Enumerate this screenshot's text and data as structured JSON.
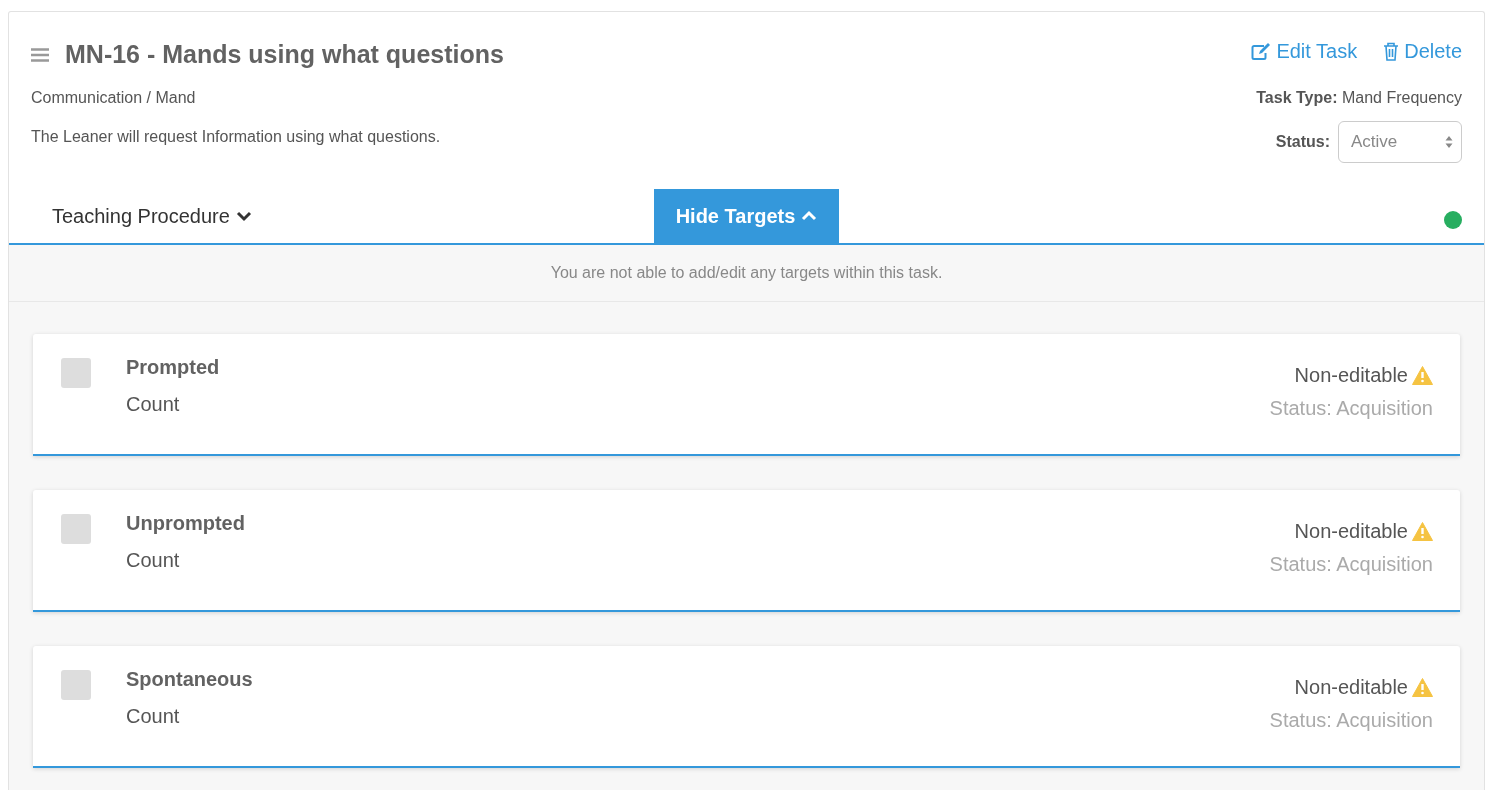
{
  "task": {
    "title": "MN-16 - Mands using what questions",
    "category": "Communication / Mand",
    "description": "The Leaner will request Information using what questions.",
    "actions": [
      {
        "kind": "edit",
        "label": "Edit Task"
      },
      {
        "kind": "delete",
        "label": "Delete"
      }
    ],
    "task_type": {
      "label": "Task Type:",
      "value": "Mand Frequency"
    },
    "status": {
      "label": "Status:",
      "value": "Active"
    }
  },
  "tabs": [
    {
      "label": "Teaching Procedure",
      "selected": false,
      "expanded": false
    },
    {
      "label": "Hide Targets",
      "selected": true,
      "expanded": true
    }
  ],
  "notice": "You are not able to add/edit any targets within this task.",
  "targets": [
    {
      "name": "Prompted",
      "measure": "Count",
      "checked": false,
      "editability": "Non-editable",
      "status": "Status: Acquisition"
    },
    {
      "name": "Unprompted",
      "measure": "Count",
      "checked": false,
      "editability": "Non-editable",
      "status": "Status: Acquisition"
    },
    {
      "name": "Spontaneous",
      "measure": "Count",
      "checked": false,
      "editability": "Non-editable",
      "status": "Status: Acquisition"
    }
  ]
}
